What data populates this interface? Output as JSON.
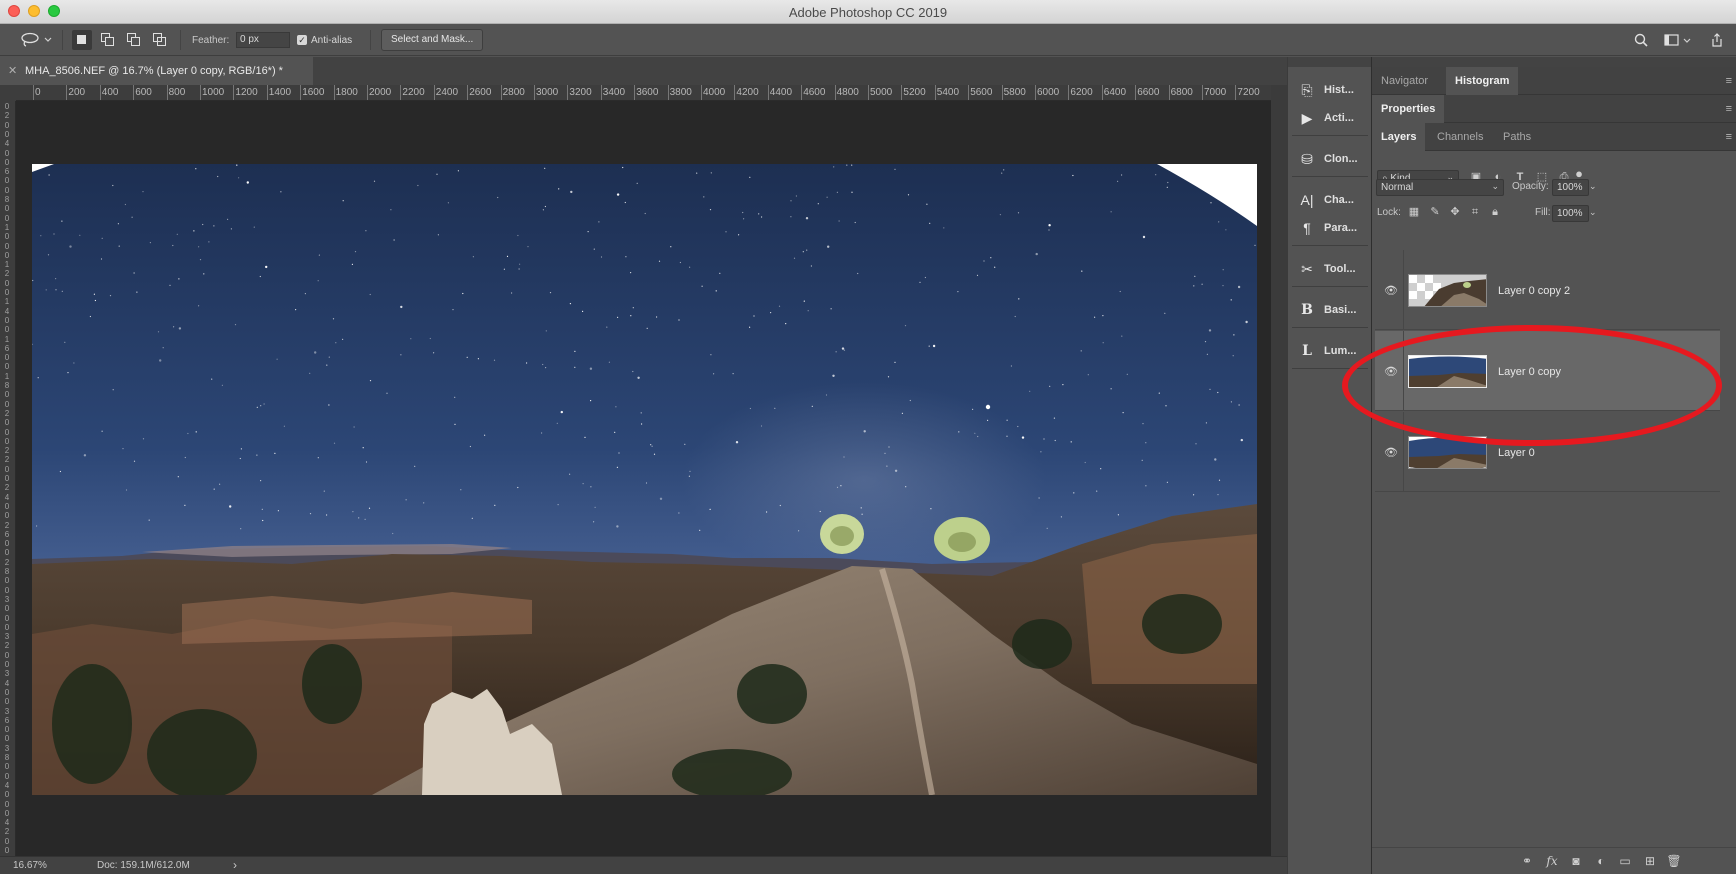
{
  "app": {
    "window_title": "Adobe Photoshop CC 2019"
  },
  "options_bar": {
    "feather_label": "Feather:",
    "feather_value": "0 px",
    "antialias_label": "Anti-alias",
    "antialias_checked": true,
    "select_mask_label": "Select and Mask..."
  },
  "document": {
    "tab_title": "MHA_8506.NEF @ 16.7% (Layer 0 copy, RGB/16*) *",
    "zoom": "16.67%",
    "doc_size": "Doc: 159.1M/612.0M"
  },
  "ruler": {
    "top_labels": [
      "0",
      "200",
      "400",
      "600",
      "800",
      "1000",
      "1200",
      "1400",
      "1600",
      "1800",
      "2000",
      "2200",
      "2400",
      "2600",
      "2800",
      "3000",
      "3200",
      "3400",
      "3600",
      "3800",
      "4000",
      "4200",
      "4400",
      "4600",
      "4800",
      "5000",
      "5200",
      "5400",
      "5600",
      "5800",
      "6000",
      "6200",
      "6400",
      "6600",
      "6800",
      "7000",
      "7200"
    ],
    "left_labels": [
      "0",
      "2",
      "0",
      "0",
      "4",
      "0",
      "0",
      "6",
      "0",
      "0",
      "8",
      "0",
      "0",
      "1",
      "0",
      "0",
      "0",
      "1",
      "2",
      "0",
      "0",
      "1",
      "4",
      "0",
      "0",
      "1",
      "6",
      "0",
      "0",
      "1",
      "8",
      "0",
      "0",
      "2",
      "0",
      "0",
      "0",
      "2",
      "2",
      "0",
      "0",
      "2",
      "4",
      "0",
      "0",
      "2",
      "6",
      "0",
      "0",
      "2",
      "8",
      "0",
      "0",
      "3",
      "0",
      "0",
      "0",
      "3",
      "2",
      "0",
      "0",
      "3",
      "4",
      "0",
      "0",
      "3",
      "6",
      "0",
      "0",
      "3",
      "8",
      "0",
      "0",
      "4",
      "0",
      "0",
      "0",
      "4",
      "2",
      "0",
      "0"
    ]
  },
  "dock": {
    "items": [
      {
        "label": "Hist...",
        "icon": "history-icon"
      },
      {
        "label": "Acti...",
        "icon": "play-icon"
      },
      {
        "label": "Clon...",
        "icon": "clone-source-icon"
      },
      {
        "label": "Cha...",
        "icon": "character-icon"
      },
      {
        "label": "Para...",
        "icon": "paragraph-icon"
      },
      {
        "label": "Tool...",
        "icon": "tool-presets-icon"
      },
      {
        "label": "Basi...",
        "icon": "basic-icon"
      },
      {
        "label": "Lum...",
        "icon": "luminosity-icon"
      }
    ]
  },
  "panels": {
    "group1_tabs": [
      "Navigator",
      "Histogram"
    ],
    "group1_active": "Histogram",
    "group2_tabs": [
      "Properties"
    ],
    "group3_tabs": [
      "Layers",
      "Channels",
      "Paths"
    ],
    "group3_active": "Layers",
    "kind_filter": "Kind",
    "blend_mode": "Normal",
    "opacity_label": "Opacity:",
    "opacity_value": "100%",
    "lock_label": "Lock:",
    "fill_label": "Fill:",
    "fill_value": "100%"
  },
  "layers": [
    {
      "name": "Layer 0 copy 2",
      "visible": true,
      "selected": false
    },
    {
      "name": "Layer 0 copy",
      "visible": true,
      "selected": true
    },
    {
      "name": "Layer 0",
      "visible": true,
      "selected": false
    }
  ],
  "colors": {
    "annotation_red": "#e6191f",
    "panel_bg": "#535353",
    "canvas_bg": "#282828",
    "selected_layer": "#686868"
  }
}
